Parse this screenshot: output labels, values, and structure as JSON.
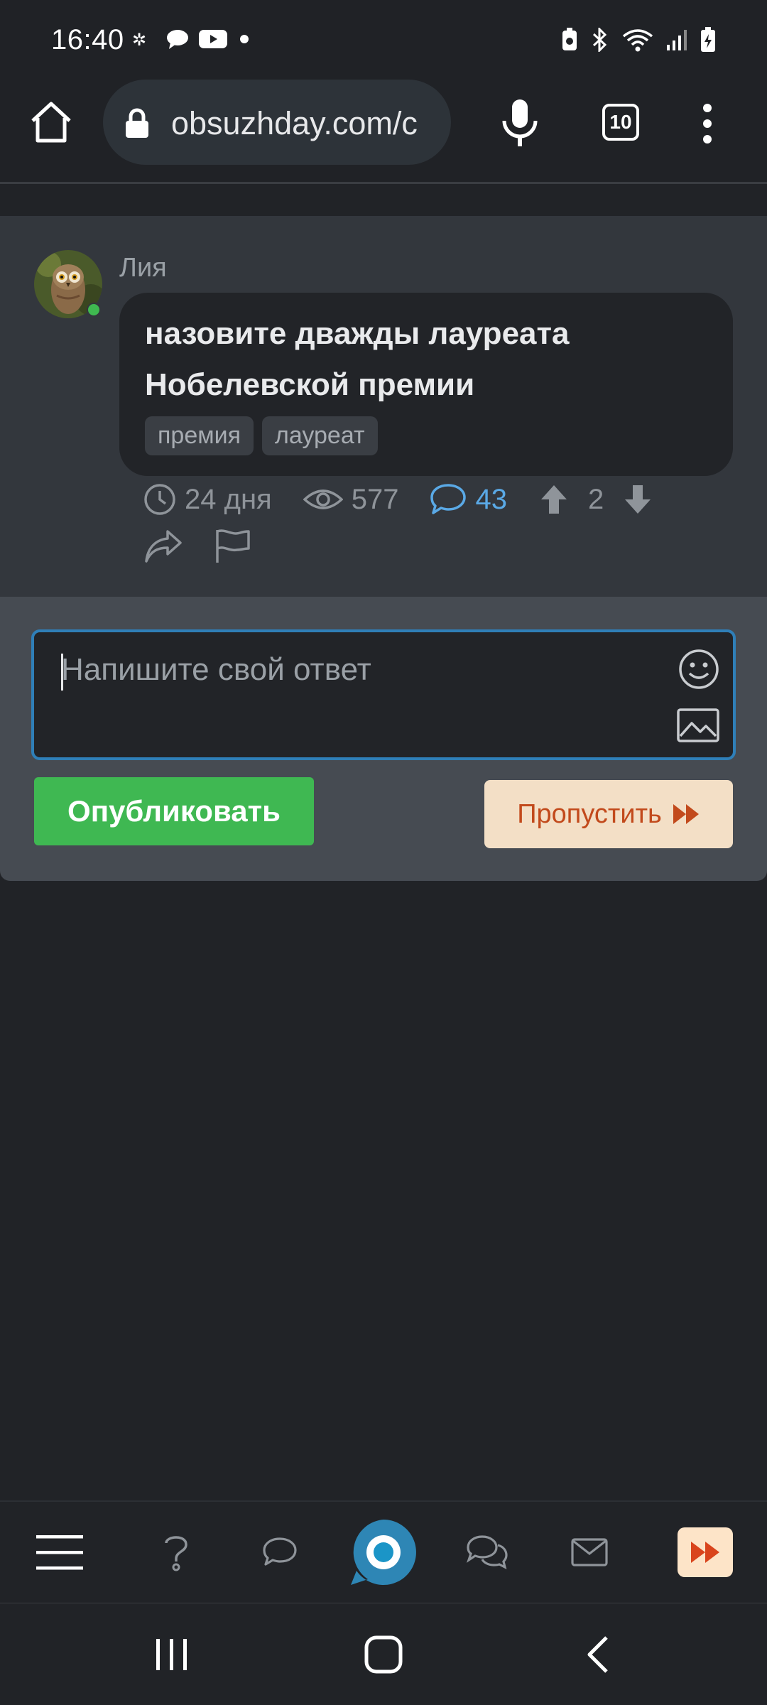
{
  "status_bar": {
    "time": "16:40"
  },
  "browser": {
    "url": "obsuzhday.com/c",
    "tab_count": "10"
  },
  "question": {
    "author": "Лия",
    "title_line1": "назовите дважды лауреата",
    "title_line2": "Нобелевской премии",
    "tags": [
      "премия",
      "лауреат"
    ],
    "age": "24 дня",
    "views": "577",
    "comments": "43",
    "votes": "2"
  },
  "answer": {
    "placeholder": "Напишите свой ответ",
    "publish_label": "Опубликовать",
    "skip_label": "Пропустить"
  },
  "colors": {
    "accent_green": "#3fb852",
    "accent_blue": "#5aa9e6",
    "skip_bg": "#f3dfc6",
    "skip_text": "#c24a1c",
    "focus_border": "#2f7fb8"
  }
}
